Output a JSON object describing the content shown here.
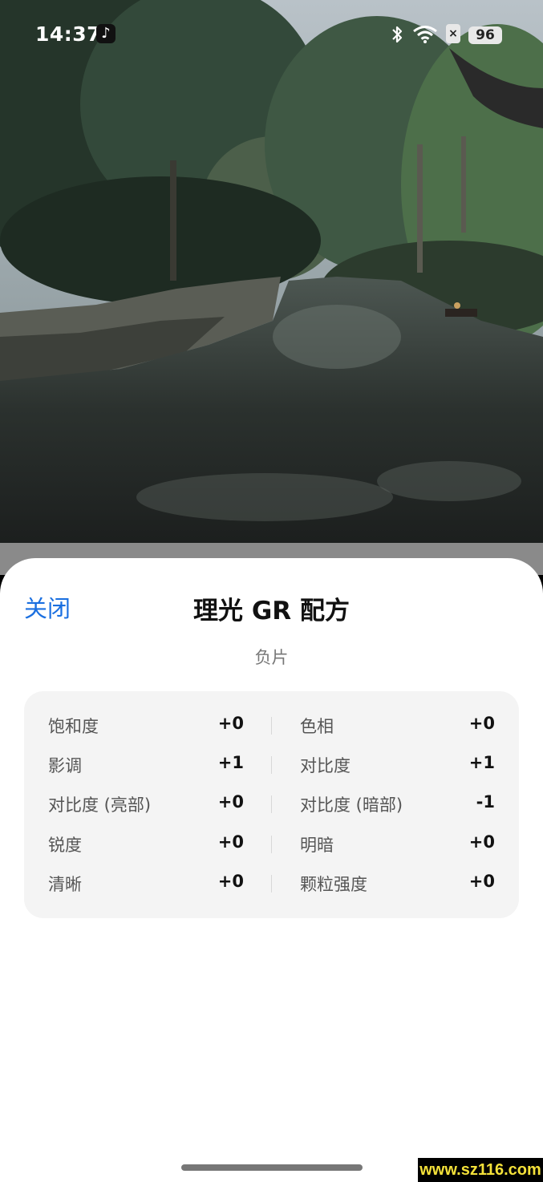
{
  "status_bar": {
    "time": "14:37",
    "battery": "96",
    "icons": [
      "tiktok-icon",
      "bluetooth-icon",
      "wifi-icon",
      "sim-off-icon",
      "battery-icon"
    ]
  },
  "sheet": {
    "close_label": "关闭",
    "title": "理光 GR 配方",
    "subtitle": "负片"
  },
  "params": [
    {
      "left_label": "饱和度",
      "left_value": "+0",
      "right_label": "色相",
      "right_value": "+0"
    },
    {
      "left_label": "影调",
      "left_value": "+1",
      "right_label": "对比度",
      "right_value": "+1"
    },
    {
      "left_label": "对比度 (亮部)",
      "left_value": "+0",
      "right_label": "对比度 (暗部)",
      "right_value": "-1"
    },
    {
      "left_label": "锐度",
      "left_value": "+0",
      "right_label": "明暗",
      "right_value": "+0"
    },
    {
      "left_label": "清晰",
      "left_value": "+0",
      "right_label": "颗粒强度",
      "right_value": "+0"
    }
  ],
  "watermark": "www.sz116.com",
  "colors": {
    "accent": "#1a6fe0",
    "sheet_bg": "#ffffff",
    "card_bg": "#f4f4f4"
  }
}
